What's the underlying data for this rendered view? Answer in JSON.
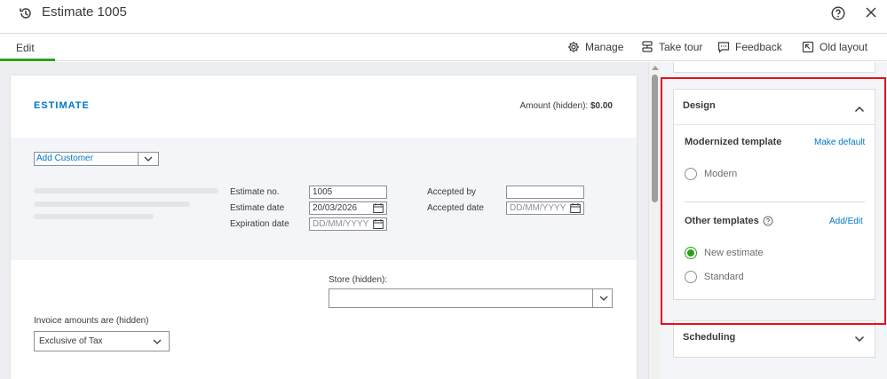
{
  "window": {
    "title": "Estimate 1005",
    "icons": [
      "history-icon",
      "help-icon",
      "close-icon"
    ]
  },
  "toolbar": {
    "edit_tab": "Edit",
    "manage": "Manage",
    "take_tour": "Take tour",
    "feedback": "Feedback",
    "old_layout": "Old layout"
  },
  "estimate": {
    "heading": "ESTIMATE",
    "amount_label": "Amount (hidden):",
    "amount_value": "$0.00",
    "customer_select": "Add Customer",
    "estimate_no_label": "Estimate no.",
    "estimate_no_value": "1005",
    "estimate_date_label": "Estimate date",
    "estimate_date_value": "20/03/2026",
    "expiration_date_label": "Expiration date",
    "expiration_date_placeholder": "DD/MM/YYYY",
    "accepted_by_label": "Accepted by",
    "accepted_by_value": "",
    "accepted_date_label": "Accepted date",
    "accepted_date_placeholder": "DD/MM/YYYY",
    "store_label": "Store (hidden):",
    "store_value": "",
    "invoice_amounts_label": "Invoice amounts are (hidden)",
    "invoice_amounts_value": "Exclusive of Tax"
  },
  "panel": {
    "design": {
      "title": "Design",
      "modernized_title": "Modernized template",
      "make_default": "Make default",
      "modern_option": "Modern",
      "other_title": "Other templates",
      "add_edit": "Add/Edit",
      "new_estimate_option": "New estimate",
      "standard_option": "Standard",
      "selected": "New estimate"
    },
    "scheduling": {
      "title": "Scheduling"
    }
  },
  "colors": {
    "accent_green": "#2ca01c",
    "link_blue": "#0077c5",
    "highlight_red": "#e2131a"
  }
}
